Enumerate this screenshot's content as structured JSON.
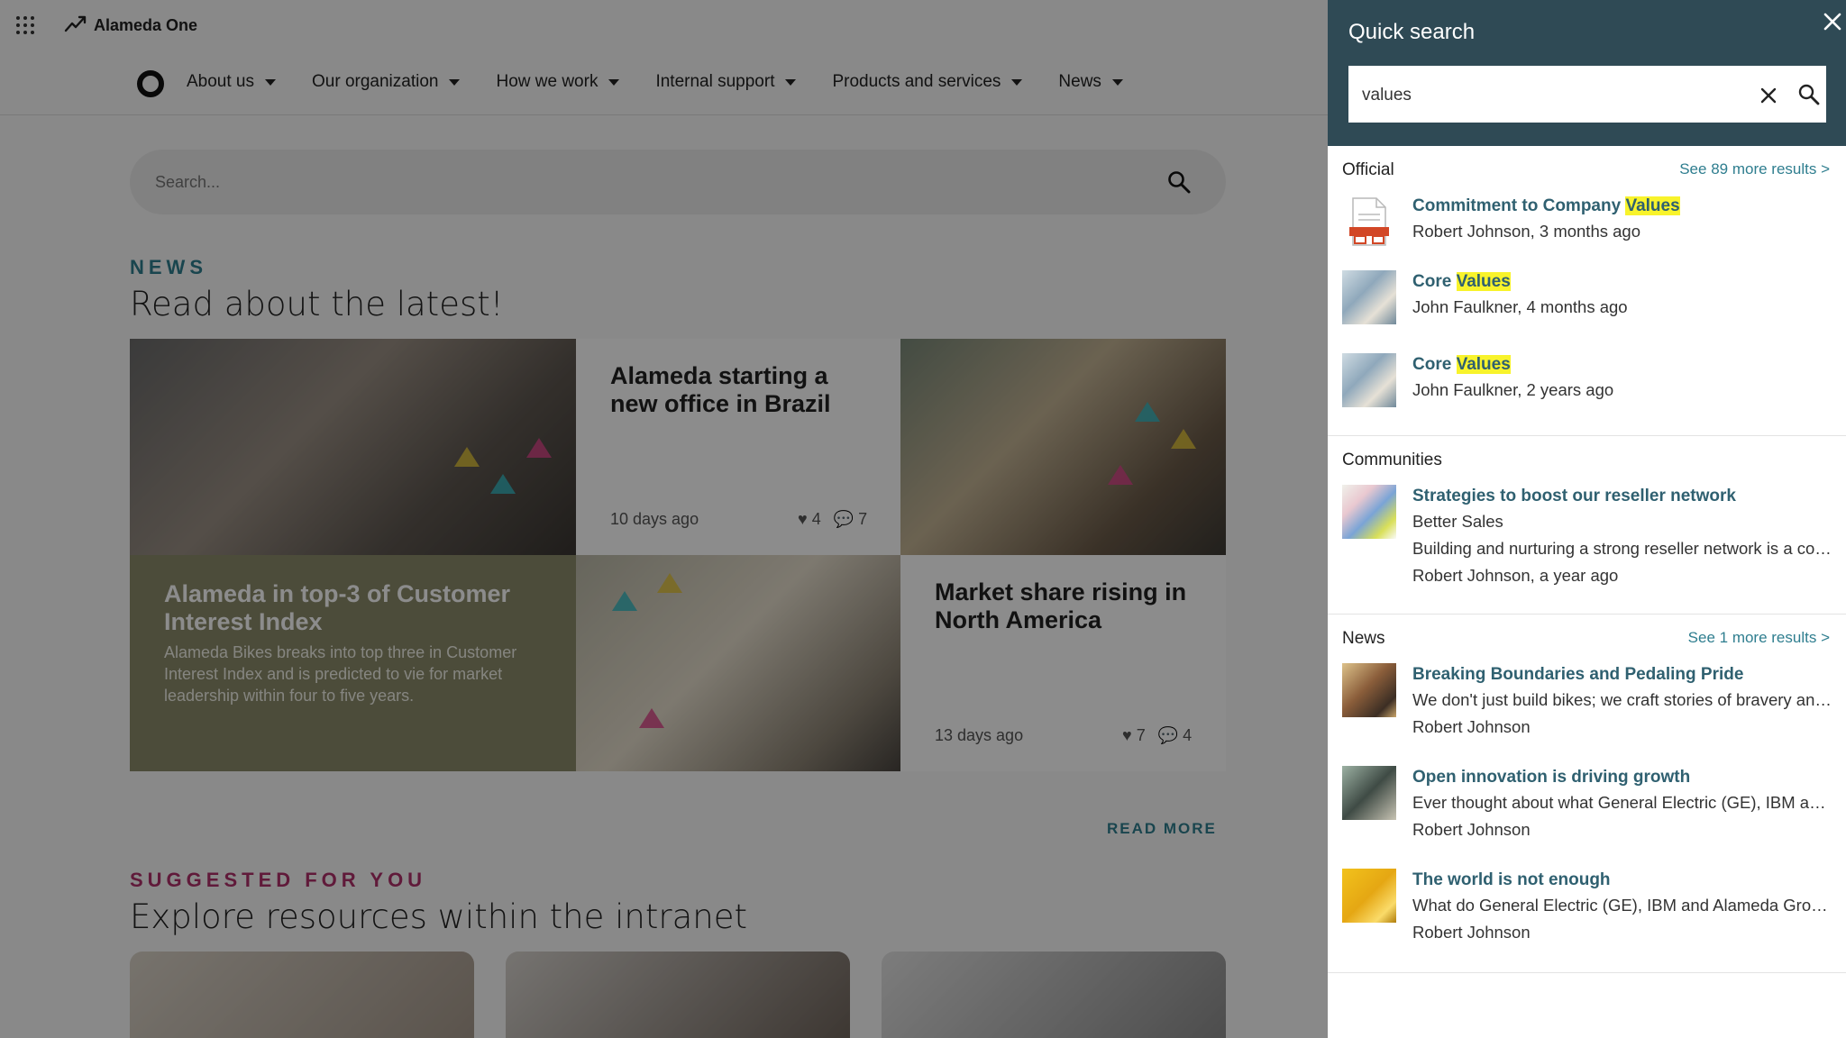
{
  "app": {
    "name": "Alameda One"
  },
  "nav": {
    "items": [
      {
        "label": "About us"
      },
      {
        "label": "Our organization"
      },
      {
        "label": "How we work"
      },
      {
        "label": "Internal support"
      },
      {
        "label": "Products and services"
      },
      {
        "label": "News"
      }
    ]
  },
  "page_search": {
    "placeholder": "Search..."
  },
  "news_section": {
    "eyebrow": "NEWS",
    "title": "Read about the latest!",
    "tiles": [
      {
        "title": "Alameda starting a new office in Brazil",
        "date": "10 days ago",
        "likes": "4",
        "comments": "7"
      },
      {
        "title": "Alameda in top-3 of Customer Interest Index",
        "description": "Alameda Bikes breaks into top three in Customer Interest Index and is predicted to vie for market leadership within four to five years."
      },
      {
        "title": "Market share rising in North America",
        "date": "13 days ago",
        "likes": "7",
        "comments": "4"
      }
    ],
    "read_more": "READ MORE"
  },
  "suggested_section": {
    "eyebrow": "SUGGESTED FOR YOU",
    "title": "Explore resources within the intranet"
  },
  "quick_search": {
    "title": "Quick search",
    "query": "values",
    "groups": [
      {
        "label": "Official",
        "see_more": "See 89 more results >",
        "items": [
          {
            "title_prefix": "Commitment to Company ",
            "title_highlight": "Values",
            "lines": [
              "Robert Johnson, 3 months ago"
            ],
            "thumb": "document-icon"
          },
          {
            "title_prefix": "Core ",
            "title_highlight": "Values",
            "lines": [
              "John Faulkner, 4 months ago"
            ],
            "thumb": "office-photo"
          },
          {
            "title_prefix": "Core ",
            "title_highlight": "Values",
            "lines": [
              "John Faulkner, 2 years ago"
            ],
            "thumb": "office-photo"
          }
        ]
      },
      {
        "label": "Communities",
        "see_more": "",
        "items": [
          {
            "title_prefix": "Strategies to boost our reseller network",
            "title_highlight": "",
            "lines": [
              "Better Sales",
              "Building and nurturing a strong reseller network is a cornerstone",
              "Robert Johnson, a year ago"
            ],
            "thumb": "board-game-photo"
          }
        ]
      },
      {
        "label": "News",
        "see_more": "See 1 more results >",
        "items": [
          {
            "title_prefix": "Breaking Boundaries and Pedaling Pride",
            "title_highlight": "",
            "lines": [
              "We don't just build bikes; we craft stories of bravery and pride",
              "Robert Johnson"
            ],
            "thumb": "bike-photo"
          },
          {
            "title_prefix": "Open innovation is driving growth",
            "title_highlight": "",
            "lines": [
              "Ever thought about what General Electric (GE), IBM and Alameda share",
              "Robert Johnson"
            ],
            "thumb": "bike-photo"
          },
          {
            "title_prefix": "The world is not enough",
            "title_highlight": "",
            "lines": [
              "What do General Electric (GE), IBM and Alameda Group have in common",
              "Robert Johnson"
            ],
            "thumb": "yellow-photo"
          }
        ]
      }
    ]
  }
}
